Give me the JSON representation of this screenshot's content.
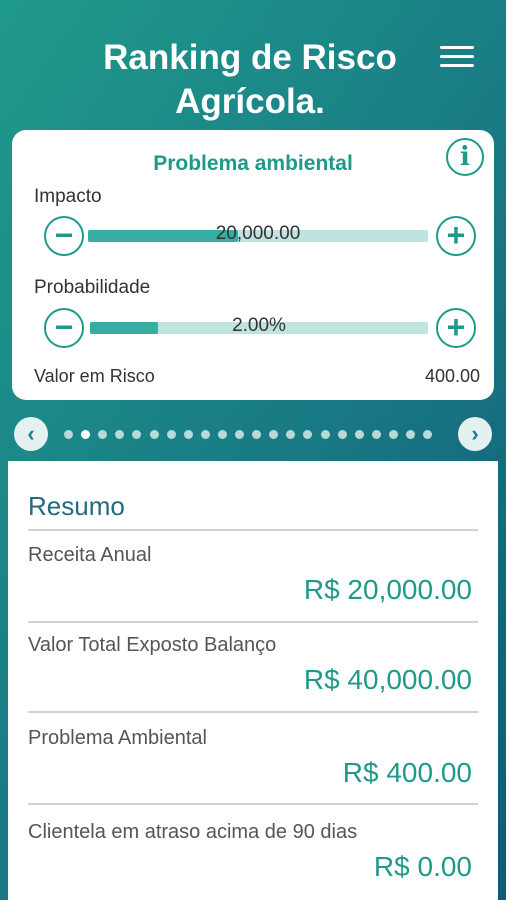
{
  "header": {
    "title_line1": "Ranking de Risco",
    "title_line2": "Agrícola."
  },
  "card": {
    "title": "Problema ambiental",
    "info_icon": "i",
    "impact": {
      "label": "Impacto",
      "value_text": "20,000.00",
      "fill_fraction": 0.44
    },
    "probability": {
      "label": "Probabilidade",
      "value_text": "2.00%",
      "fill_fraction": 0.2
    },
    "risk": {
      "label": "Valor em Risco",
      "value": "400.00"
    },
    "minus_icon": "−",
    "plus_icon": "+"
  },
  "carousel": {
    "prev_icon": "‹",
    "next_icon": "›",
    "page_count": 22,
    "active_index": 1
  },
  "summary": {
    "title": "Resumo",
    "items": [
      {
        "label": "Receita Anual",
        "value": "R$ 20,000.00"
      },
      {
        "label": "Valor Total Exposto Balanço",
        "value": "R$ 40,000.00"
      },
      {
        "label": "Problema Ambiental",
        "value": "R$ 400.00"
      },
      {
        "label": "Clientela em atraso acima de 90 dias",
        "value": "R$ 0.00"
      }
    ]
  },
  "colors": {
    "accent": "#1f9a8a",
    "track": "#bfe3df",
    "fill": "#36aca3",
    "heading": "#1f6c7d"
  }
}
